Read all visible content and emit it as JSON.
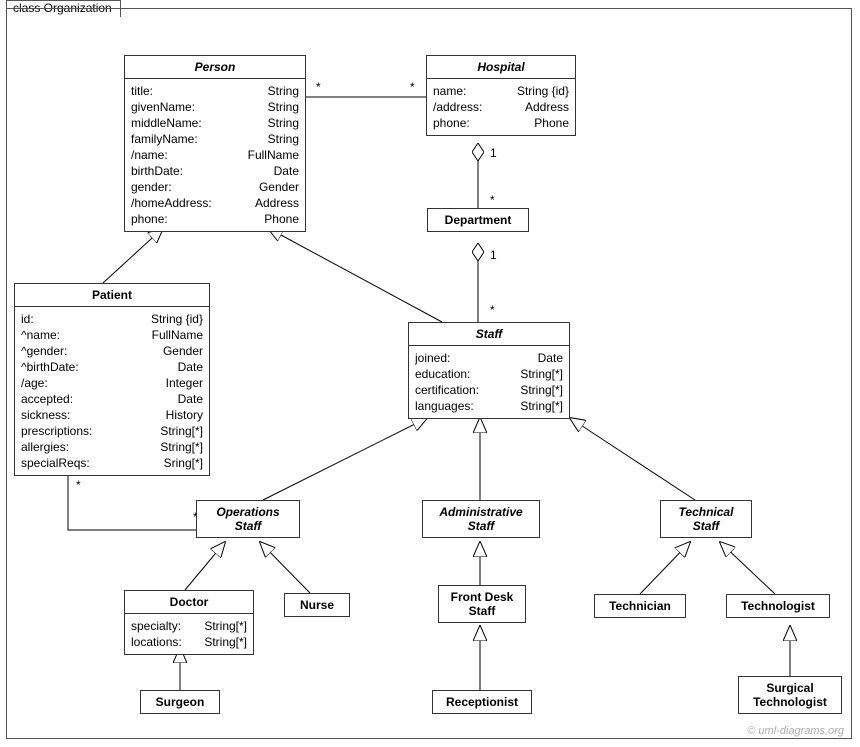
{
  "frame": {
    "title": "class Organization"
  },
  "credit": "© uml-diagrams.org",
  "classes": {
    "person": {
      "name": "Person",
      "attrs": [
        {
          "n": "title:",
          "t": "String"
        },
        {
          "n": "givenName:",
          "t": "String"
        },
        {
          "n": "middleName:",
          "t": "String"
        },
        {
          "n": "familyName:",
          "t": "String"
        },
        {
          "n": "/name:",
          "t": "FullName"
        },
        {
          "n": "birthDate:",
          "t": "Date"
        },
        {
          "n": "gender:",
          "t": "Gender"
        },
        {
          "n": "/homeAddress:",
          "t": "Address"
        },
        {
          "n": "phone:",
          "t": "Phone"
        }
      ]
    },
    "hospital": {
      "name": "Hospital",
      "attrs": [
        {
          "n": "name:",
          "t": "String {id}"
        },
        {
          "n": "/address:",
          "t": "Address"
        },
        {
          "n": "phone:",
          "t": "Phone"
        }
      ]
    },
    "department": {
      "name": "Department",
      "attrs": []
    },
    "patient": {
      "name": "Patient",
      "attrs": [
        {
          "n": "id:",
          "t": "String {id}"
        },
        {
          "n": "^name:",
          "t": "FullName"
        },
        {
          "n": "^gender:",
          "t": "Gender"
        },
        {
          "n": "^birthDate:",
          "t": "Date"
        },
        {
          "n": "/age:",
          "t": "Integer"
        },
        {
          "n": "accepted:",
          "t": "Date"
        },
        {
          "n": "sickness:",
          "t": "History"
        },
        {
          "n": "prescriptions:",
          "t": "String[*]"
        },
        {
          "n": "allergies:",
          "t": "String[*]"
        },
        {
          "n": "specialReqs:",
          "t": "Sring[*]"
        }
      ]
    },
    "staff": {
      "name": "Staff",
      "attrs": [
        {
          "n": "joined:",
          "t": "Date"
        },
        {
          "n": "education:",
          "t": "String[*]"
        },
        {
          "n": "certification:",
          "t": "String[*]"
        },
        {
          "n": "languages:",
          "t": "String[*]"
        }
      ]
    },
    "operationsStaff": {
      "name": "Operations\nStaff",
      "attrs": []
    },
    "administrativeStaff": {
      "name": "Administrative\nStaff",
      "attrs": []
    },
    "technicalStaff": {
      "name": "Technical\nStaff",
      "attrs": []
    },
    "doctor": {
      "name": "Doctor",
      "attrs": [
        {
          "n": "specialty:",
          "t": "String[*]"
        },
        {
          "n": "locations:",
          "t": "String[*]"
        }
      ]
    },
    "nurse": {
      "name": "Nurse",
      "attrs": []
    },
    "frontDeskStaff": {
      "name": "Front Desk\nStaff",
      "attrs": []
    },
    "technician": {
      "name": "Technician",
      "attrs": []
    },
    "technologist": {
      "name": "Technologist",
      "attrs": []
    },
    "surgeon": {
      "name": "Surgeon",
      "attrs": []
    },
    "receptionist": {
      "name": "Receptionist",
      "attrs": []
    },
    "surgicalTechnologist": {
      "name": "Surgical\nTechnologist",
      "attrs": []
    }
  },
  "multiplicities": {
    "person_hospital_left": "*",
    "person_hospital_right": "*",
    "hospital_department_top": "1",
    "hospital_department_bottom": "*",
    "department_staff_top": "1",
    "department_staff_bottom": "*",
    "patient_opstaff_patient": "*",
    "patient_opstaff_opstaff": "*"
  }
}
